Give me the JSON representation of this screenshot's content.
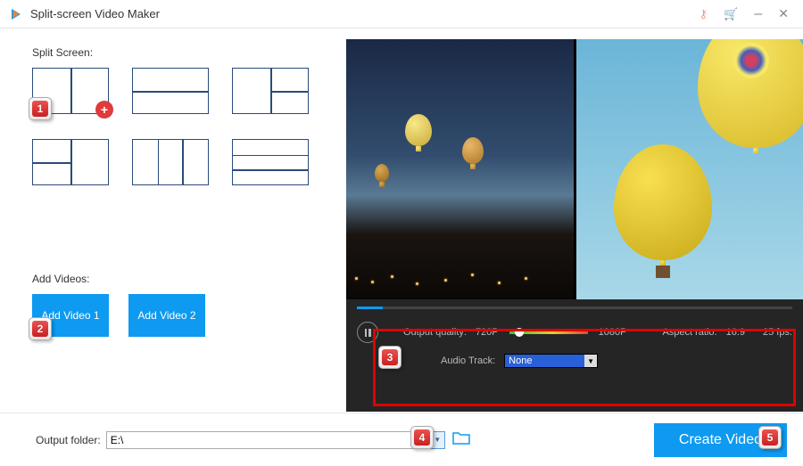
{
  "titlebar": {
    "title": "Split-screen Video Maker"
  },
  "left": {
    "split_label": "Split Screen:",
    "add_videos_label": "Add Videos:",
    "add_video_1": "Add Video 1",
    "add_video_2": "Add Video 2"
  },
  "controls": {
    "output_quality_label": "Output quality:",
    "quality_low": "720P",
    "quality_high": "1080P",
    "aspect_label": "Aspect ratio:",
    "aspect_value": "16:9",
    "fps": "25 fps.",
    "audio_label": "Audio Track:",
    "audio_value": "None"
  },
  "footer": {
    "folder_label": "Output folder:",
    "folder_value": "E:\\",
    "create_label": "Create Video"
  },
  "callouts": {
    "c1": "1",
    "c2": "2",
    "c3": "3",
    "c4": "4",
    "c5": "5"
  }
}
